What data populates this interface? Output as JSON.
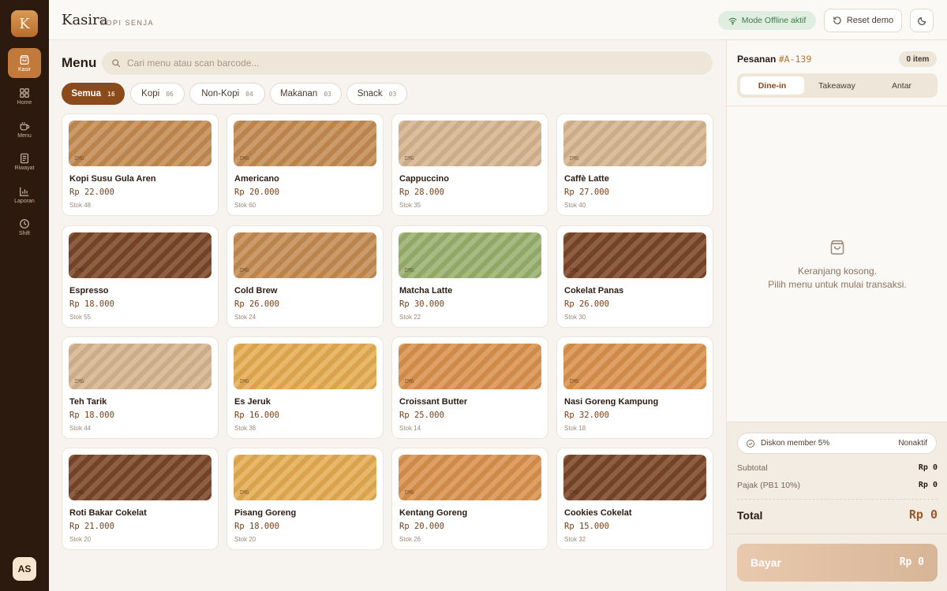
{
  "sidebar": {
    "logo": "K",
    "items": [
      {
        "label": "Kasir",
        "icon": "shopping-bag-icon",
        "active": true
      },
      {
        "label": "Home",
        "icon": "grid-icon",
        "active": false
      },
      {
        "label": "Menu",
        "icon": "coffee-cup-icon",
        "active": false
      },
      {
        "label": "Riwayat",
        "icon": "document-icon",
        "active": false
      },
      {
        "label": "Laporan",
        "icon": "bar-chart-icon",
        "active": false
      },
      {
        "label": "Shift",
        "icon": "clock-icon",
        "active": false
      }
    ],
    "user_initials": "AS"
  },
  "header": {
    "brand": "Kasira",
    "store": "KOPI SENJA",
    "offline_badge": "Mode Offline aktif",
    "reset_label": "Reset demo"
  },
  "menu": {
    "title": "Menu",
    "search_placeholder": "Cari menu atau scan barcode...",
    "categories": [
      {
        "label": "Semua",
        "count": "16",
        "active": true
      },
      {
        "label": "Kopi",
        "count": "06",
        "active": false
      },
      {
        "label": "Non-Kopi",
        "count": "04",
        "active": false
      },
      {
        "label": "Makanan",
        "count": "03",
        "active": false
      },
      {
        "label": "Snack",
        "count": "03",
        "active": false
      }
    ],
    "image_tag": "IMG",
    "products": [
      {
        "name": "Kopi Susu Gula Aren",
        "price": "Rp 22.000",
        "stock": "Stok 48",
        "color": "#c48b52"
      },
      {
        "name": "Americano",
        "price": "Rp 20.000",
        "stock": "Stok 60",
        "color": "#c48b52"
      },
      {
        "name": "Cappuccino",
        "price": "Rp 28.000",
        "stock": "Stok 35",
        "color": "#d6b48f"
      },
      {
        "name": "Caffè Latte",
        "price": "Rp 27.000",
        "stock": "Stok 40",
        "color": "#d6b48f"
      },
      {
        "name": "Espresso",
        "price": "Rp 18.000",
        "stock": "Stok 55",
        "color": "#7a4628"
      },
      {
        "name": "Cold Brew",
        "price": "Rp 26.000",
        "stock": "Stok 24",
        "color": "#c48b52"
      },
      {
        "name": "Matcha Latte",
        "price": "Rp 30.000",
        "stock": "Stok 22",
        "color": "#98b06e"
      },
      {
        "name": "Cokelat Panas",
        "price": "Rp 26.000",
        "stock": "Stok 30",
        "color": "#7a4628"
      },
      {
        "name": "Teh Tarik",
        "price": "Rp 18.000",
        "stock": "Stok 44",
        "color": "#d6b48f"
      },
      {
        "name": "Es Jeruk",
        "price": "Rp 16.000",
        "stock": "Stok 38",
        "color": "#e5ac52"
      },
      {
        "name": "Croissant Butter",
        "price": "Rp 25.000",
        "stock": "Stok 14",
        "color": "#d9914c"
      },
      {
        "name": "Nasi Goreng Kampung",
        "price": "Rp 32.000",
        "stock": "Stok 18",
        "color": "#d9914c"
      },
      {
        "name": "Roti Bakar Cokelat",
        "price": "Rp 21.000",
        "stock": "Stok 20",
        "color": "#7a4628"
      },
      {
        "name": "Pisang Goreng",
        "price": "Rp 18.000",
        "stock": "Stok 20",
        "color": "#e5ac52"
      },
      {
        "name": "Kentang Goreng",
        "price": "Rp 20.000",
        "stock": "Stok 26",
        "color": "#d9914c"
      },
      {
        "name": "Cookies Cokelat",
        "price": "Rp 15.000",
        "stock": "Stok 32",
        "color": "#7a4628"
      }
    ]
  },
  "order": {
    "title": "Pesanan",
    "id": "#A-139",
    "item_count": "0 item",
    "types": [
      {
        "label": "Dine-in",
        "active": true
      },
      {
        "label": "Takeaway",
        "active": false
      },
      {
        "label": "Antar",
        "active": false
      }
    ],
    "empty_line1": "Keranjang kosong.",
    "empty_line2": "Pilih menu untuk mulai transaksi.",
    "discount_label": "Diskon member 5%",
    "discount_status": "Nonaktif",
    "subtotal_label": "Subtotal",
    "subtotal_value": "Rp 0",
    "tax_label": "Pajak (PB1 10%)",
    "tax_value": "Rp 0",
    "total_label": "Total",
    "total_value": "Rp 0",
    "pay_label": "Bayar",
    "pay_amount": "Rp 0"
  },
  "colors": {
    "sidebar_bg": "#2c1a0f",
    "accent": "#c27a3c",
    "active_chip": "#8a4a1c",
    "price": "#7b3f17",
    "offline_green": "#3c7a47"
  }
}
